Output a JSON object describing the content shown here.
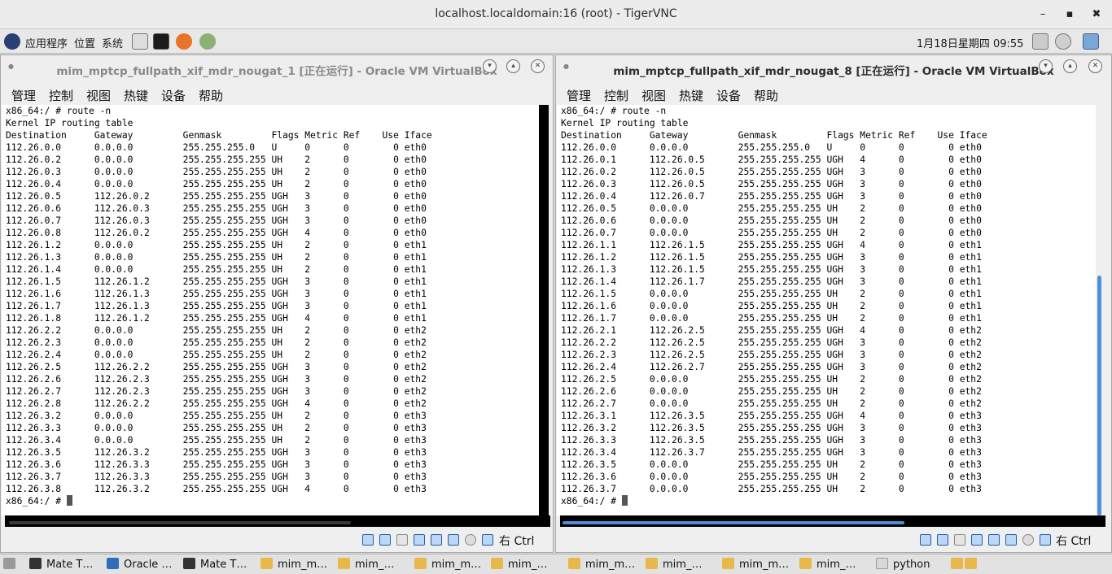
{
  "tigervnc": {
    "title": "localhost.localdomain:16 (root) - TigerVNC",
    "min": "–",
    "max": "▪",
    "close": "✖"
  },
  "panel": {
    "apps": "应用程序",
    "places": "位置",
    "system": "系统",
    "datetime": "1月18日星期四 09:55"
  },
  "left_vm": {
    "title": "mim_mptcp_fullpath_xif_mdr_nougat_1 [正在运行] - Oracle VM VirtualBox",
    "menu": [
      "管理",
      "控制",
      "视图",
      "热键",
      "设备",
      "帮助"
    ],
    "host_key": "右 Ctrl",
    "terminal": [
      "x86_64:/ # route -n",
      "Kernel IP routing table",
      "Destination     Gateway         Genmask         Flags Metric Ref    Use Iface",
      "112.26.0.0      0.0.0.0         255.255.255.0   U     0      0        0 eth0",
      "112.26.0.2      0.0.0.0         255.255.255.255 UH    2      0        0 eth0",
      "112.26.0.3      0.0.0.0         255.255.255.255 UH    2      0        0 eth0",
      "112.26.0.4      0.0.0.0         255.255.255.255 UH    2      0        0 eth0",
      "112.26.0.5      112.26.0.2      255.255.255.255 UGH   3      0        0 eth0",
      "112.26.0.6      112.26.0.3      255.255.255.255 UGH   3      0        0 eth0",
      "112.26.0.7      112.26.0.3      255.255.255.255 UGH   3      0        0 eth0",
      "112.26.0.8      112.26.0.2      255.255.255.255 UGH   4      0        0 eth0",
      "112.26.1.2      0.0.0.0         255.255.255.255 UH    2      0        0 eth1",
      "112.26.1.3      0.0.0.0         255.255.255.255 UH    2      0        0 eth1",
      "112.26.1.4      0.0.0.0         255.255.255.255 UH    2      0        0 eth1",
      "112.26.1.5      112.26.1.2      255.255.255.255 UGH   3      0        0 eth1",
      "112.26.1.6      112.26.1.3      255.255.255.255 UGH   3      0        0 eth1",
      "112.26.1.7      112.26.1.3      255.255.255.255 UGH   3      0        0 eth1",
      "112.26.1.8      112.26.1.2      255.255.255.255 UGH   4      0        0 eth1",
      "112.26.2.2      0.0.0.0         255.255.255.255 UH    2      0        0 eth2",
      "112.26.2.3      0.0.0.0         255.255.255.255 UH    2      0        0 eth2",
      "112.26.2.4      0.0.0.0         255.255.255.255 UH    2      0        0 eth2",
      "112.26.2.5      112.26.2.2      255.255.255.255 UGH   3      0        0 eth2",
      "112.26.2.6      112.26.2.3      255.255.255.255 UGH   3      0        0 eth2",
      "112.26.2.7      112.26.2.3      255.255.255.255 UGH   3      0        0 eth2",
      "112.26.2.8      112.26.2.2      255.255.255.255 UGH   4      0        0 eth2",
      "112.26.3.2      0.0.0.0         255.255.255.255 UH    2      0        0 eth3",
      "112.26.3.3      0.0.0.0         255.255.255.255 UH    2      0        0 eth3",
      "112.26.3.4      0.0.0.0         255.255.255.255 UH    2      0        0 eth3",
      "112.26.3.5      112.26.3.2      255.255.255.255 UGH   3      0        0 eth3",
      "112.26.3.6      112.26.3.3      255.255.255.255 UGH   3      0        0 eth3",
      "112.26.3.7      112.26.3.3      255.255.255.255 UGH   3      0        0 eth3",
      "112.26.3.8      112.26.3.2      255.255.255.255 UGH   4      0        0 eth3"
    ],
    "prompt": "x86_64:/ # "
  },
  "right_vm": {
    "title": "mim_mptcp_fullpath_xif_mdr_nougat_8 [正在运行] - Oracle VM VirtualBox",
    "menu": [
      "管理",
      "控制",
      "视图",
      "热键",
      "设备",
      "帮助"
    ],
    "host_key": "右 Ctrl",
    "terminal": [
      "x86_64:/ # route -n",
      "Kernel IP routing table",
      "Destination     Gateway         Genmask         Flags Metric Ref    Use Iface",
      "112.26.0.0      0.0.0.0         255.255.255.0   U     0      0        0 eth0",
      "112.26.0.1      112.26.0.5      255.255.255.255 UGH   4      0        0 eth0",
      "112.26.0.2      112.26.0.5      255.255.255.255 UGH   3      0        0 eth0",
      "112.26.0.3      112.26.0.5      255.255.255.255 UGH   3      0        0 eth0",
      "112.26.0.4      112.26.0.7      255.255.255.255 UGH   3      0        0 eth0",
      "112.26.0.5      0.0.0.0         255.255.255.255 UH    2      0        0 eth0",
      "112.26.0.6      0.0.0.0         255.255.255.255 UH    2      0        0 eth0",
      "112.26.0.7      0.0.0.0         255.255.255.255 UH    2      0        0 eth0",
      "112.26.1.1      112.26.1.5      255.255.255.255 UGH   4      0        0 eth1",
      "112.26.1.2      112.26.1.5      255.255.255.255 UGH   3      0        0 eth1",
      "112.26.1.3      112.26.1.5      255.255.255.255 UGH   3      0        0 eth1",
      "112.26.1.4      112.26.1.7      255.255.255.255 UGH   3      0        0 eth1",
      "112.26.1.5      0.0.0.0         255.255.255.255 UH    2      0        0 eth1",
      "112.26.1.6      0.0.0.0         255.255.255.255 UH    2      0        0 eth1",
      "112.26.1.7      0.0.0.0         255.255.255.255 UH    2      0        0 eth1",
      "112.26.2.1      112.26.2.5      255.255.255.255 UGH   4      0        0 eth2",
      "112.26.2.2      112.26.2.5      255.255.255.255 UGH   3      0        0 eth2",
      "112.26.2.3      112.26.2.5      255.255.255.255 UGH   3      0        0 eth2",
      "112.26.2.4      112.26.2.7      255.255.255.255 UGH   3      0        0 eth2",
      "112.26.2.5      0.0.0.0         255.255.255.255 UH    2      0        0 eth2",
      "112.26.2.6      0.0.0.0         255.255.255.255 UH    2      0        0 eth2",
      "112.26.2.7      0.0.0.0         255.255.255.255 UH    2      0        0 eth2",
      "112.26.3.1      112.26.3.5      255.255.255.255 UGH   4      0        0 eth3",
      "112.26.3.2      112.26.3.5      255.255.255.255 UGH   3      0        0 eth3",
      "112.26.3.3      112.26.3.5      255.255.255.255 UGH   3      0        0 eth3",
      "112.26.3.4      112.26.3.7      255.255.255.255 UGH   3      0        0 eth3",
      "112.26.3.5      0.0.0.0         255.255.255.255 UH    2      0        0 eth3",
      "112.26.3.6      0.0.0.0         255.255.255.255 UH    2      0        0 eth3",
      "112.26.3.7      0.0.0.0         255.255.255.255 UH    2      0        0 eth3"
    ],
    "prompt": "x86_64:/ # "
  },
  "taskbar": [
    "Mate T…",
    "Oracle …",
    "Mate T…",
    "mim_m…",
    "mim_…",
    "mim_m…",
    "mim_…",
    "mim_m…",
    "mim_…",
    "mim_m…",
    "mim_…",
    "python"
  ],
  "colors": {
    "accent": "#4a90d9",
    "terminal_bg": "#ffffff",
    "desktop": "#d9d9d9"
  }
}
